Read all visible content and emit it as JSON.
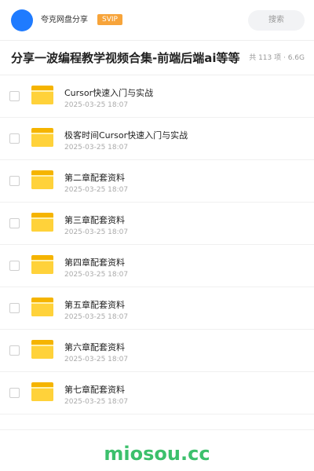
{
  "header": {
    "share_name": "夸克网盘分享",
    "badge": "SVIP",
    "search_placeholder": "搜索"
  },
  "share": {
    "title": "分享一波编程教学视频合集-前端后端ai等等",
    "meta": "共 113 项 · 6.6G"
  },
  "files": [
    {
      "name": "Cursor快速入门与实战",
      "date": "2025-03-25 18:07",
      "icon": "folder-icon"
    },
    {
      "name": "极客时间Cursor快速入门与实战",
      "date": "2025-03-25 18:07",
      "icon": "folder-icon"
    },
    {
      "name": "第二章配套资料",
      "date": "2025-03-25 18:07",
      "icon": "folder-icon"
    },
    {
      "name": "第三章配套资料",
      "date": "2025-03-25 18:07",
      "icon": "folder-icon"
    },
    {
      "name": "第四章配套资料",
      "date": "2025-03-25 18:07",
      "icon": "folder-icon"
    },
    {
      "name": "第五章配套资料",
      "date": "2025-03-25 18:07",
      "icon": "folder-icon"
    },
    {
      "name": "第六章配套资料",
      "date": "2025-03-25 18:07",
      "icon": "folder-icon"
    },
    {
      "name": "第七章配套资料",
      "date": "2025-03-25 18:07",
      "icon": "folder-icon"
    }
  ],
  "footer": {
    "brand": "miosou.cc"
  },
  "colors": {
    "avatar": "#1f7bff",
    "badge": "#f7a43a",
    "folder": "#ffd23a",
    "brand": "#3cc06c"
  }
}
